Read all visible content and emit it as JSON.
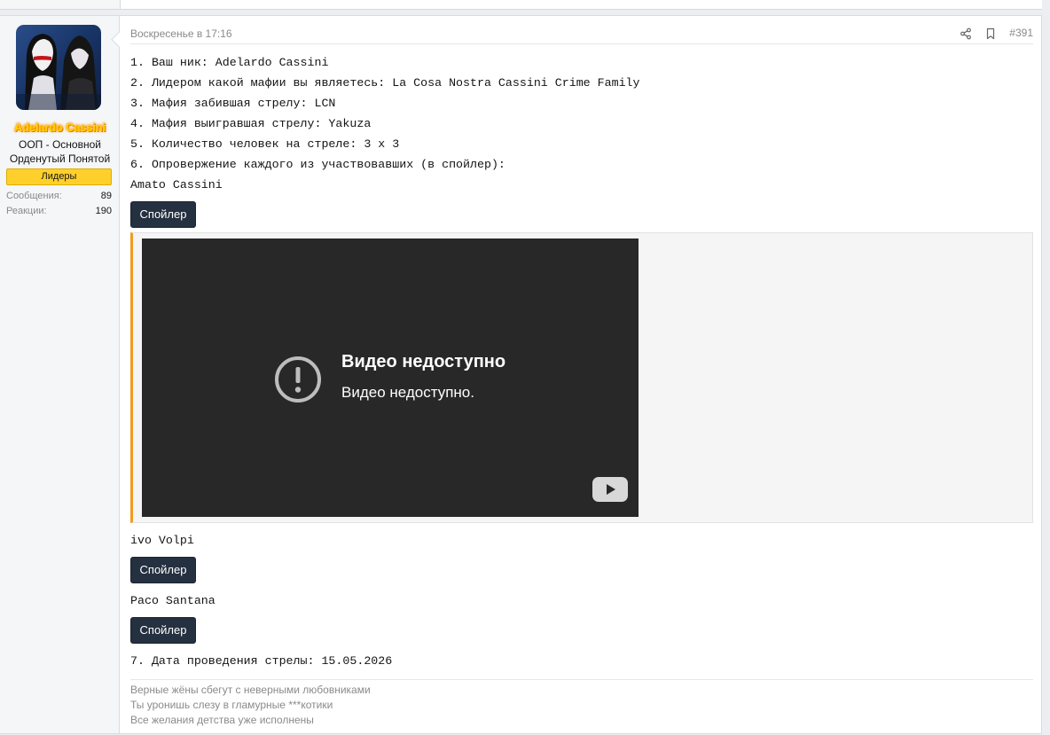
{
  "author": {
    "name": "Adelardo Cassini",
    "title_line1": "ООП - Основной",
    "title_line2": "Орденутый Понятой",
    "banner": "Лидеры",
    "stats": [
      {
        "label": "Сообщения:",
        "value": "89"
      },
      {
        "label": "Реакции:",
        "value": "190"
      }
    ]
  },
  "post": {
    "date": "Воскресенье в 17:16",
    "number": "#391",
    "lines": [
      "1. Ваш ник: Adelardo Cassini",
      "2. Лидером какой мафии вы являетесь: La Cosa Nostra Cassini Crime Family",
      "3. Мафия забившая стрелу: LCN",
      "4. Мафия выигравшая стрелу: Yakuza",
      "5. Количество человек на стреле: 3 x 3",
      "6. Опровержение каждого из участвовавших (в спойлер):"
    ],
    "participants": [
      "Amato Cassini",
      "ivo Volpi",
      "Paco Santana"
    ],
    "spoiler_label": "Спойлер",
    "video": {
      "title": "Видео недоступно",
      "message": "Видео недоступно."
    },
    "date_line": "7. Дата проведения стрелы: 15.05.2026"
  },
  "signature": [
    "Верные жёны сбегут с неверными любовниками",
    "Ты уронишь слезу в гламурные ***котики",
    "Все желания детства уже исполнены"
  ],
  "colors": {
    "accent": "#f29c1f",
    "button": "#253040",
    "banner": "#ffd02b",
    "username": "#ffd200"
  }
}
